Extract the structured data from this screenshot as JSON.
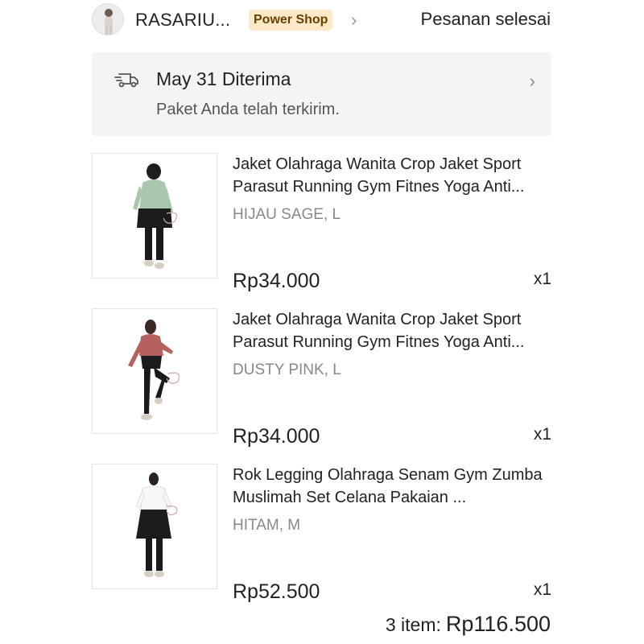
{
  "header": {
    "shop_name": "RASARIU...",
    "badge": "Power Shop",
    "status": "Pesanan selesai"
  },
  "delivery": {
    "title": "May 31 Diterima",
    "subtitle": "Paket Anda telah terkirim."
  },
  "items": [
    {
      "name": "Jaket Olahraga Wanita Crop Jaket Sport Parasut Running Gym Fitnes Yoga Anti...",
      "variant": "HIJAU SAGE, L",
      "price": "Rp34.000",
      "qty": "x1",
      "jacket_color": "#a9c7ad"
    },
    {
      "name": "Jaket Olahraga Wanita Crop Jaket Sport Parasut Running Gym Fitnes Yoga Anti...",
      "variant": "DUSTY PINK, L",
      "price": "Rp34.000",
      "qty": "x1",
      "jacket_color": "#b5615f"
    },
    {
      "name": "Rok Legging Olahraga Senam Gym Zumba Muslimah Set Celana Pakaian ...",
      "variant": "HITAM, M",
      "price": "Rp52.500",
      "qty": "x1",
      "jacket_color": "#f7f7f7"
    }
  ],
  "summary": {
    "count_label": "3 item:",
    "total": "Rp116.500"
  },
  "colors": {
    "badge_bg": "#fde9c8",
    "card_bg": "#f4f4f4",
    "muted_text": "#888888"
  }
}
